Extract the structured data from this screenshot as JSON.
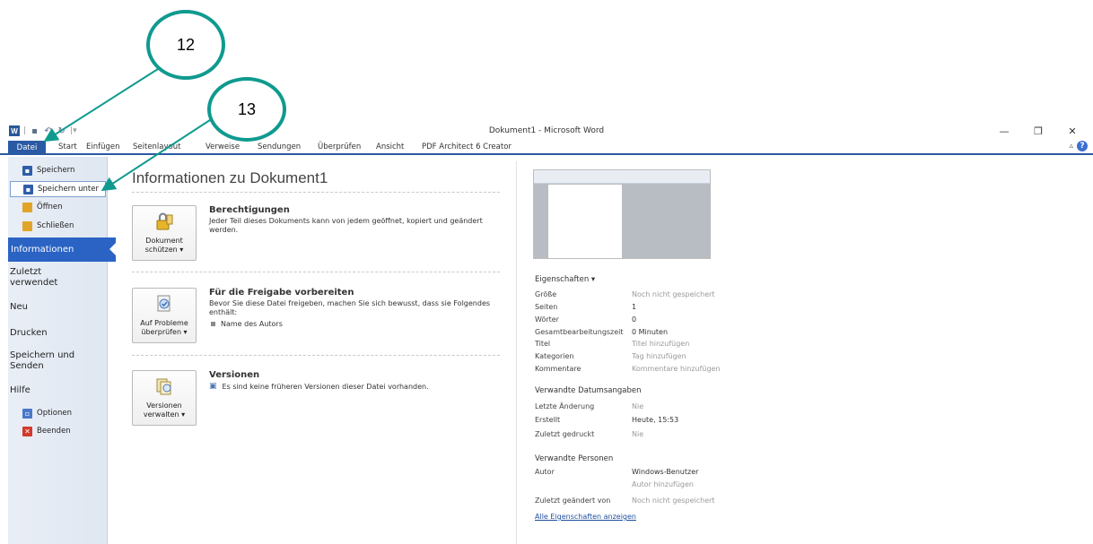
{
  "callouts": {
    "c12": "12",
    "c13": "13"
  },
  "window": {
    "title": "Dokument1  -  Microsoft Word",
    "app_badge": "W"
  },
  "tabs": [
    "Datei",
    "Start",
    "Einfügen",
    "Seitenlayout",
    "Verweise",
    "Sendungen",
    "Überprüfen",
    "Ansicht",
    "PDF Architect 6 Creator"
  ],
  "nav": {
    "commands": [
      {
        "label": "Speichern",
        "icon": "save-icon",
        "color": "#2f5ea8"
      },
      {
        "label": "Speichern unter",
        "icon": "save-as-icon",
        "color": "#2f5ea8"
      },
      {
        "label": "Öffnen",
        "icon": "open-folder-icon",
        "color": "#e0a528"
      },
      {
        "label": "Schließen",
        "icon": "close-folder-icon",
        "color": "#e0a528"
      }
    ],
    "categories": [
      "Informationen",
      "Zuletzt\nverwendet",
      "Neu",
      "Drucken",
      "Speichern und\nSenden",
      "Hilfe"
    ],
    "bottom": [
      {
        "label": "Optionen",
        "icon": "options-icon",
        "color": "#4a78c8"
      },
      {
        "label": "Beenden",
        "icon": "exit-icon",
        "color": "#d23a2b"
      }
    ]
  },
  "main": {
    "title": "Informationen zu Dokument1",
    "sections": [
      {
        "button": "Dokument\nschützen ▾",
        "heading": "Berechtigungen",
        "desc": "Jeder Teil dieses Dokuments kann von jedem geöffnet, kopiert und geändert werden.",
        "icon": "lock-icon"
      },
      {
        "button": "Auf Probleme\nüberprüfen ▾",
        "heading": "Für die Freigabe vorbereiten",
        "desc": "Bevor Sie diese Datei freigeben, machen Sie sich bewusst, dass sie Folgendes enthält:",
        "bullet": "Name des Autors",
        "icon": "check-document-icon"
      },
      {
        "button": "Versionen\nverwalten ▾",
        "heading": "Versionen",
        "desc": "Es sind keine früheren Versionen dieser Datei vorhanden.",
        "icon": "versions-icon"
      }
    ]
  },
  "properties": {
    "title": "Eigenschaften ▾",
    "rows": [
      {
        "k": "Größe",
        "v": "Noch nicht gespeichert",
        "muted": true
      },
      {
        "k": "Seiten",
        "v": "1",
        "muted": false
      },
      {
        "k": "Wörter",
        "v": "0",
        "muted": false
      },
      {
        "k": "Gesamtbearbeitungszeit",
        "v": "0 Minuten",
        "muted": false
      },
      {
        "k": "Titel",
        "v": "Titel hinzufügen",
        "muted": true
      },
      {
        "k": "Kategorien",
        "v": "Tag hinzufügen",
        "muted": true
      },
      {
        "k": "Kommentare",
        "v": "Kommentare hinzufügen",
        "muted": true
      }
    ],
    "dates_title": "Verwandte Datumsangaben",
    "dates": [
      {
        "k": "Letzte Änderung",
        "v": "Nie",
        "muted": true
      },
      {
        "k": "Erstellt",
        "v": "Heute, 15:53",
        "muted": false
      },
      {
        "k": "Zuletzt gedruckt",
        "v": "Nie",
        "muted": true
      }
    ],
    "people_title": "Verwandte Personen",
    "author_k": "Autor",
    "author_v": "Windows-Benutzer",
    "author_add": "Autor hinzufügen",
    "modified_k": "Zuletzt geändert von",
    "modified_v": "Noch nicht gespeichert",
    "show_all": "Alle Eigenschaften anzeigen"
  }
}
